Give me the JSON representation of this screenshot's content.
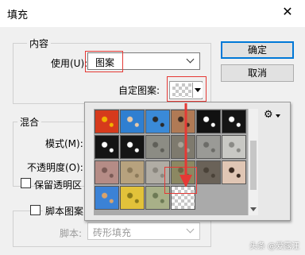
{
  "dialog": {
    "title": "填充",
    "close_glyph": "✕"
  },
  "contents": {
    "legend": "内容",
    "use_label": "使用(U):",
    "use_value": "图案",
    "custom_pattern_label": "自定图案:"
  },
  "buttons": {
    "ok": "确定",
    "cancel": "取消"
  },
  "blending": {
    "legend": "混合",
    "mode_label": "模式(M):",
    "opacity_label": "不透明度(O):",
    "preserve_transparency_label": "保留透明区"
  },
  "script": {
    "label": "脚本图案",
    "script_label": "脚本:",
    "script_value": "砖形填充"
  },
  "pattern_picker": {
    "gear_icon_glyph": "⚙",
    "patterns": [
      {
        "name": "goldfish",
        "color": "#d63a1c",
        "accent": "#f2b200"
      },
      {
        "name": "portrait-blue-1",
        "color": "#2f7fd1",
        "accent": "#e8c9a8"
      },
      {
        "name": "portrait-blue-2",
        "color": "#3a8ad8",
        "accent": "#2a2a2a"
      },
      {
        "name": "face-closeup",
        "color": "#b07a55",
        "accent": "#3a2a20"
      },
      {
        "name": "black-dots",
        "color": "#111111",
        "accent": "#ffffff"
      },
      {
        "name": "black-chinese-1",
        "color": "#151515",
        "accent": "#ffffff"
      },
      {
        "name": "black-chinese-2",
        "color": "#141414",
        "accent": "#ffffff"
      },
      {
        "name": "black-chinese-3",
        "color": "#151515",
        "accent": "#ffffff"
      },
      {
        "name": "rough-gray",
        "color": "#8c8c84",
        "accent": "#5f5f58"
      },
      {
        "name": "granite",
        "color": "#7e7a6e",
        "accent": "#a9a397"
      },
      {
        "name": "gravel-gray",
        "color": "#9a9a96",
        "accent": "#6c6c68"
      },
      {
        "name": "speckle-light",
        "color": "#c8c8c4",
        "accent": "#8a8a86"
      },
      {
        "name": "pink-rock",
        "color": "#b58c86",
        "accent": "#7a5a55"
      },
      {
        "name": "tan-stone",
        "color": "#b7a27e",
        "accent": "#8c7a5a"
      },
      {
        "name": "concrete",
        "color": "#b0aca4",
        "accent": "#8a867e"
      },
      {
        "name": "olive-stone",
        "color": "#8c8862",
        "accent": "#6a6646"
      },
      {
        "name": "dark-stone",
        "color": "#6a6258",
        "accent": "#4a4238"
      },
      {
        "name": "eye",
        "color": "#e0c6b4",
        "accent": "#3a2a20"
      },
      {
        "name": "child-portrait",
        "color": "#3b82d6",
        "accent": "#d9a36c"
      },
      {
        "name": "yellow-flowers",
        "color": "#e2c23a",
        "accent": "#8a7a1a"
      },
      {
        "name": "blurred-photo",
        "color": "#a8b088",
        "accent": "#6d7a55"
      },
      {
        "name": "transparent",
        "color": "#ffffff",
        "accent": "#c8c8c8"
      }
    ]
  },
  "watermark": "头条 @爱露汪",
  "colors": {
    "highlight": "#e53935",
    "accent_blue": "#0078d7"
  }
}
